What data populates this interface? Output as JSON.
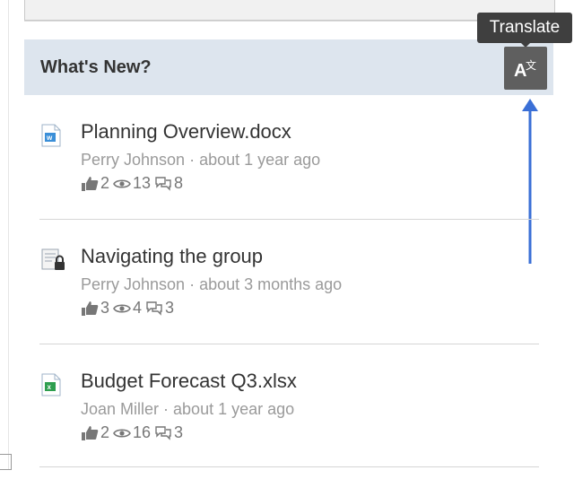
{
  "header": {
    "title": "What's New?"
  },
  "tooltip": {
    "text": "Translate"
  },
  "colors": {
    "header_bg": "#dde5ee",
    "button_bg": "#5f5f5f",
    "arrow": "#3a6fd6"
  },
  "items": [
    {
      "icon": "word-doc-icon",
      "title": "Planning Overview.docx",
      "author": "Perry Johnson",
      "time": "about 1 year ago",
      "likes": "2",
      "views": "13",
      "comments": "8"
    },
    {
      "icon": "locked-page-icon",
      "title": "Navigating the group",
      "author": "Perry Johnson",
      "time": "about 3 months ago",
      "likes": "3",
      "views": "4",
      "comments": "3"
    },
    {
      "icon": "excel-doc-icon",
      "title": "Budget Forecast Q3.xlsx",
      "author": "Joan Miller",
      "time": "about 1 year ago",
      "likes": "2",
      "views": "16",
      "comments": "3"
    }
  ],
  "meta_separator": " · "
}
